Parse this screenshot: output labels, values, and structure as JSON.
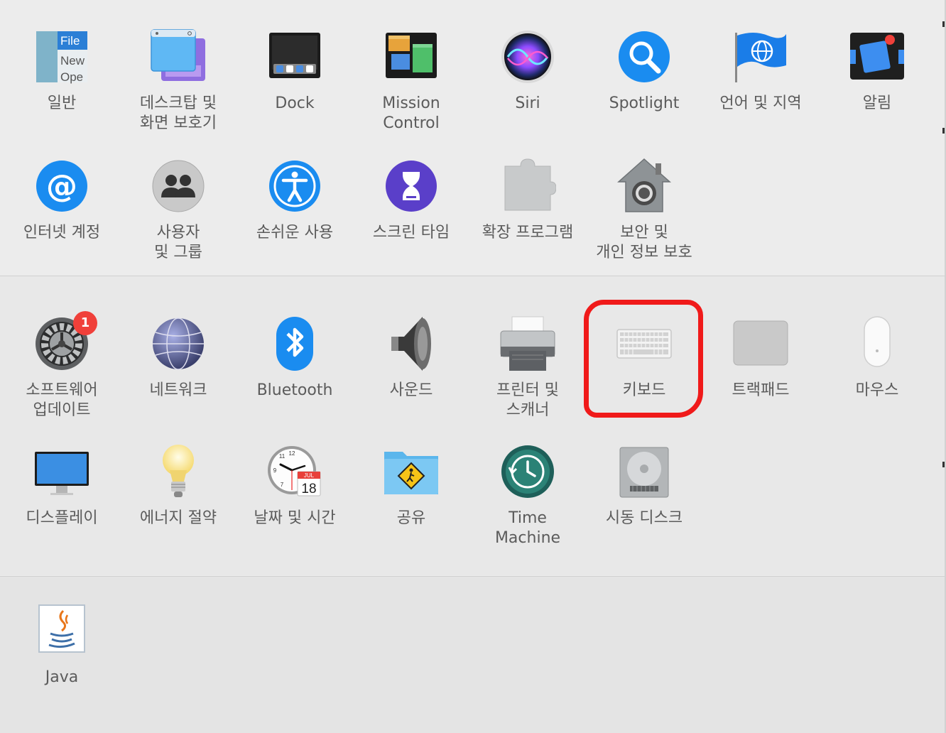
{
  "sections": [
    {
      "items": [
        {
          "label": "일반",
          "icon": "general-icon"
        },
        {
          "label": "데스크탑 및\n화면 보호기",
          "icon": "desktop-screensaver-icon"
        },
        {
          "label": "Dock",
          "icon": "dock-icon"
        },
        {
          "label": "Mission\nControl",
          "icon": "mission-control-icon"
        },
        {
          "label": "Siri",
          "icon": "siri-icon"
        },
        {
          "label": "Spotlight",
          "icon": "spotlight-icon"
        },
        {
          "label": "언어 및 지역",
          "icon": "language-region-icon"
        },
        {
          "label": "알림",
          "icon": "notifications-icon"
        },
        {
          "label": "인터넷 계정",
          "icon": "internet-accounts-icon"
        },
        {
          "label": "사용자\n및 그룹",
          "icon": "users-groups-icon"
        },
        {
          "label": "손쉬운 사용",
          "icon": "accessibility-icon"
        },
        {
          "label": "스크린 타임",
          "icon": "screen-time-icon"
        },
        {
          "label": "확장 프로그램",
          "icon": "extensions-icon"
        },
        {
          "label": "보안 및\n개인 정보 보호",
          "icon": "security-privacy-icon"
        }
      ]
    },
    {
      "items": [
        {
          "label": "소프트웨어\n업데이트",
          "icon": "software-update-icon",
          "badge": "1"
        },
        {
          "label": "네트워크",
          "icon": "network-icon"
        },
        {
          "label": "Bluetooth",
          "icon": "bluetooth-icon"
        },
        {
          "label": "사운드",
          "icon": "sound-icon"
        },
        {
          "label": "프린터 및\n스캐너",
          "icon": "printers-scanners-icon"
        },
        {
          "label": "키보드",
          "icon": "keyboard-icon"
        },
        {
          "label": "트랙패드",
          "icon": "trackpad-icon"
        },
        {
          "label": "마우스",
          "icon": "mouse-icon"
        },
        {
          "label": "디스플레이",
          "icon": "displays-icon"
        },
        {
          "label": "에너지 절약",
          "icon": "energy-saver-icon"
        },
        {
          "label": "날짜 및 시간",
          "icon": "date-time-icon"
        },
        {
          "label": "공유",
          "icon": "sharing-icon"
        },
        {
          "label": "Time\nMachine",
          "icon": "time-machine-icon"
        },
        {
          "label": "시동 디스크",
          "icon": "startup-disk-icon"
        }
      ]
    },
    {
      "items": [
        {
          "label": "Java",
          "icon": "java-icon"
        }
      ]
    }
  ],
  "icon_text": {
    "general_file": "File",
    "general_new": "New",
    "general_open": "Ope",
    "calendar_month": "JUL",
    "calendar_day": "18",
    "clock_12": "12",
    "clock_11": "11",
    "clock_9": "9",
    "clock_7": "7"
  },
  "colors": {
    "highlight": "#f01a1a",
    "badge": "#f0403a",
    "accent_blue": "#1a8cf0"
  }
}
